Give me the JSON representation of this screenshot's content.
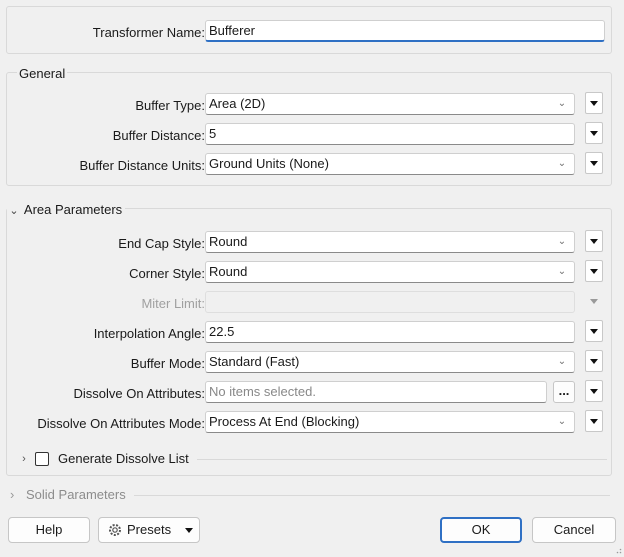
{
  "transformer": {
    "label": "Transformer Name:",
    "value": "Bufferer"
  },
  "general": {
    "title": "General",
    "rows": [
      {
        "label": "Buffer Type:",
        "value": "Area (2D)",
        "kind": "select"
      },
      {
        "label": "Buffer Distance:",
        "value": "5",
        "kind": "text"
      },
      {
        "label": "Buffer Distance Units:",
        "value": "Ground Units (None)",
        "kind": "select"
      }
    ]
  },
  "area": {
    "title": "Area Parameters",
    "end_cap": {
      "label": "End Cap Style:",
      "value": "Round"
    },
    "corner": {
      "label": "Corner Style:",
      "value": "Round"
    },
    "miter": {
      "label": "Miter Limit:",
      "value": ""
    },
    "interp": {
      "label": "Interpolation Angle:",
      "value": "22.5"
    },
    "mode": {
      "label": "Buffer Mode:",
      "value": "Standard (Fast)"
    },
    "dissolve": {
      "label": "Dissolve On Attributes:",
      "placeholder": "No items selected.",
      "ellipsis": "..."
    },
    "dissolve_mode": {
      "label": "Dissolve On Attributes Mode:",
      "value": "Process At End (Blocking)"
    },
    "generate": {
      "label": "Generate Dissolve List",
      "checked": false
    }
  },
  "solid": {
    "title": "Solid Parameters"
  },
  "footer": {
    "help": "Help",
    "presets": "Presets",
    "ok": "OK",
    "cancel": "Cancel"
  },
  "icons": {
    "chevron": "chevron-down-icon",
    "menu": "dropdown-triangle-icon",
    "expand": "chevron-right-icon",
    "collapse": "chevron-down-icon",
    "presets": "gear-icon"
  }
}
